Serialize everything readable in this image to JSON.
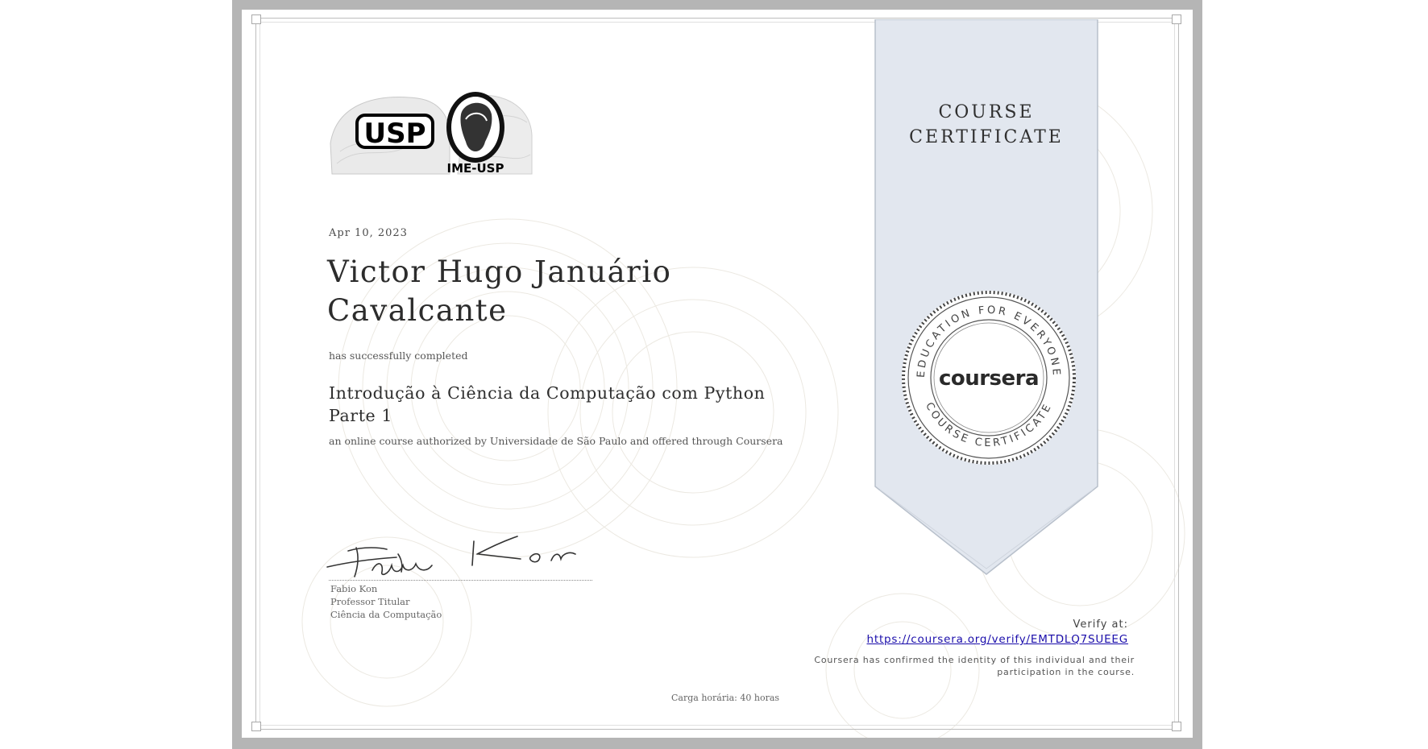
{
  "certificate": {
    "date": "Apr 10, 2023",
    "recipient_line1": "Victor Hugo Januário",
    "recipient_line2": "Cavalcante",
    "completed_text": "has successfully completed",
    "course_line1": "Introdução à Ciência da Computação com Python",
    "course_line2": "Parte 1",
    "offered_text": "an online course authorized by Universidade de São Paulo and offered through Coursera",
    "hours_text": "Carga horária: 40 horas"
  },
  "logo": {
    "usp_text": "USP",
    "ime_text": "IME-USP"
  },
  "ribbon": {
    "title_line1": "COURSE",
    "title_line2": "CERTIFICATE"
  },
  "seal": {
    "brand": "coursera",
    "top_arc": "EDUCATION FOR EVERYONE",
    "bottom_arc": "COURSE CERTIFICATE"
  },
  "signer": {
    "name": "Fabio Kon",
    "title": "Professor Titular",
    "department": "Ciência da Computação"
  },
  "verification": {
    "label": "Verify at:",
    "url": "https://coursera.org/verify/EMTDLQ7SUEEG",
    "confirm_text": "Coursera has confirmed the identity of this individual and their participation in the course."
  },
  "colors": {
    "ribbon": "#e2e7ef",
    "ribbon_border": "#b8c0cb",
    "border_gray": "#b5b5b5",
    "link": "#1a0dab"
  }
}
